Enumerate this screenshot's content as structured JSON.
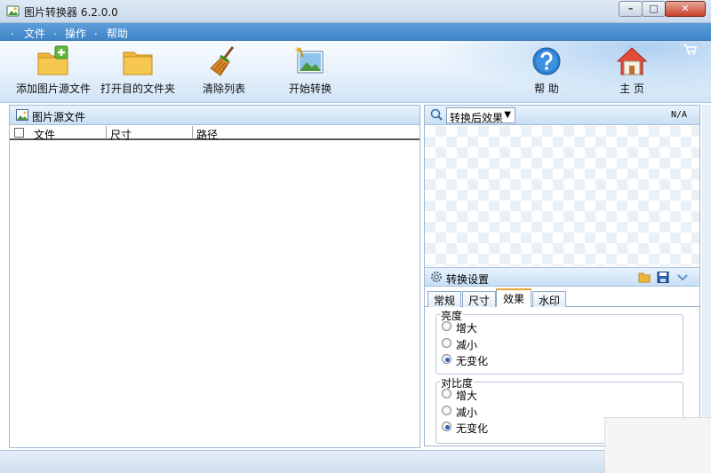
{
  "window": {
    "title": "图片转换器 6.2.0.0",
    "min_glyph": "–",
    "max_glyph": "□",
    "close_glyph": "✕"
  },
  "menu": {
    "items": [
      "文件",
      "操作",
      "帮助"
    ],
    "separator": "."
  },
  "toolbar": {
    "add_source": "添加图片源文件",
    "open_target": "打开目的文件夹",
    "clear_list": "清除列表",
    "start_convert": "开始转换",
    "help": "帮 助",
    "home": "主 页"
  },
  "source_panel": {
    "title": "图片源文件",
    "columns": [
      "文件",
      "尺寸",
      "路径"
    ],
    "rows": []
  },
  "preview_panel": {
    "mode_selected": "转换后效果",
    "info": "N/A"
  },
  "settings_panel": {
    "title": "转换设置",
    "tabs": [
      "常规",
      "尺寸",
      "效果",
      "水印"
    ],
    "active_tab": "效果",
    "brightness": {
      "label": "亮度",
      "options": [
        "增大",
        "减小",
        "无变化"
      ],
      "selected": "无变化"
    },
    "contrast": {
      "label": "对比度",
      "options": [
        "增大",
        "减小",
        "无变化"
      ],
      "selected": "无变化"
    }
  },
  "colors": {
    "menu_blue": "#4a90d0",
    "accent_tab": "#e8a336"
  },
  "icons": [
    "app-icon",
    "add-image-folder-icon",
    "open-folder-icon",
    "broom-icon",
    "start-convert-icon",
    "help-icon",
    "home-icon",
    "cart-icon",
    "image-icon",
    "zoom-icon",
    "gear-icon",
    "folder-icon",
    "save-icon",
    "collapse-icon"
  ]
}
